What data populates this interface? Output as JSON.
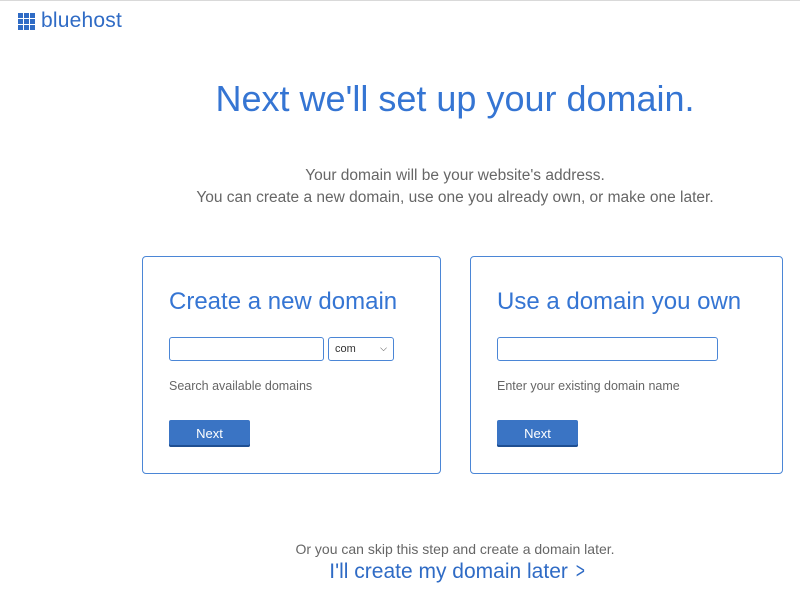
{
  "header": {
    "logo_text": "bluehost",
    "logo_icon": "grid-icon"
  },
  "main": {
    "heading": "Next we'll set up your domain.",
    "subtext_line1": "Your domain will be your website's address.",
    "subtext_line2": "You can create a new domain, use one you already own, or make one later."
  },
  "create_card": {
    "title": "Create a new domain",
    "domain_input_value": "",
    "tld_selected": "com",
    "hint": "Search available domains",
    "button_label": "Next"
  },
  "own_card": {
    "title": "Use a domain you own",
    "domain_input_value": "",
    "hint": "Enter your existing domain name",
    "button_label": "Next"
  },
  "footer": {
    "skip_text": "Or you can skip this step and create a domain later.",
    "skip_link": "I'll create my domain later",
    "skip_icon": "chevron-right-icon"
  },
  "colors": {
    "accent": "#3575d3",
    "button": "#3a74c4",
    "border": "#4b86d6"
  }
}
